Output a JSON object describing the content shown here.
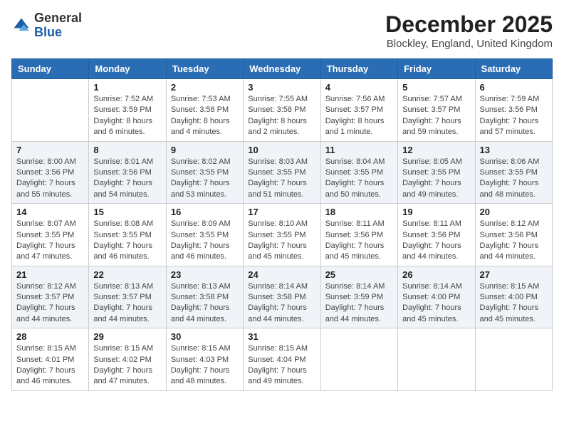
{
  "header": {
    "logo_general": "General",
    "logo_blue": "Blue",
    "month_title": "December 2025",
    "location": "Blockley, England, United Kingdom"
  },
  "days_of_week": [
    "Sunday",
    "Monday",
    "Tuesday",
    "Wednesday",
    "Thursday",
    "Friday",
    "Saturday"
  ],
  "weeks": [
    [
      {
        "day": "",
        "info": ""
      },
      {
        "day": "1",
        "info": "Sunrise: 7:52 AM\nSunset: 3:59 PM\nDaylight: 8 hours\nand 6 minutes."
      },
      {
        "day": "2",
        "info": "Sunrise: 7:53 AM\nSunset: 3:58 PM\nDaylight: 8 hours\nand 4 minutes."
      },
      {
        "day": "3",
        "info": "Sunrise: 7:55 AM\nSunset: 3:58 PM\nDaylight: 8 hours\nand 2 minutes."
      },
      {
        "day": "4",
        "info": "Sunrise: 7:56 AM\nSunset: 3:57 PM\nDaylight: 8 hours\nand 1 minute."
      },
      {
        "day": "5",
        "info": "Sunrise: 7:57 AM\nSunset: 3:57 PM\nDaylight: 7 hours\nand 59 minutes."
      },
      {
        "day": "6",
        "info": "Sunrise: 7:59 AM\nSunset: 3:56 PM\nDaylight: 7 hours\nand 57 minutes."
      }
    ],
    [
      {
        "day": "7",
        "info": "Sunrise: 8:00 AM\nSunset: 3:56 PM\nDaylight: 7 hours\nand 55 minutes."
      },
      {
        "day": "8",
        "info": "Sunrise: 8:01 AM\nSunset: 3:56 PM\nDaylight: 7 hours\nand 54 minutes."
      },
      {
        "day": "9",
        "info": "Sunrise: 8:02 AM\nSunset: 3:55 PM\nDaylight: 7 hours\nand 53 minutes."
      },
      {
        "day": "10",
        "info": "Sunrise: 8:03 AM\nSunset: 3:55 PM\nDaylight: 7 hours\nand 51 minutes."
      },
      {
        "day": "11",
        "info": "Sunrise: 8:04 AM\nSunset: 3:55 PM\nDaylight: 7 hours\nand 50 minutes."
      },
      {
        "day": "12",
        "info": "Sunrise: 8:05 AM\nSunset: 3:55 PM\nDaylight: 7 hours\nand 49 minutes."
      },
      {
        "day": "13",
        "info": "Sunrise: 8:06 AM\nSunset: 3:55 PM\nDaylight: 7 hours\nand 48 minutes."
      }
    ],
    [
      {
        "day": "14",
        "info": "Sunrise: 8:07 AM\nSunset: 3:55 PM\nDaylight: 7 hours\nand 47 minutes."
      },
      {
        "day": "15",
        "info": "Sunrise: 8:08 AM\nSunset: 3:55 PM\nDaylight: 7 hours\nand 46 minutes."
      },
      {
        "day": "16",
        "info": "Sunrise: 8:09 AM\nSunset: 3:55 PM\nDaylight: 7 hours\nand 46 minutes."
      },
      {
        "day": "17",
        "info": "Sunrise: 8:10 AM\nSunset: 3:55 PM\nDaylight: 7 hours\nand 45 minutes."
      },
      {
        "day": "18",
        "info": "Sunrise: 8:11 AM\nSunset: 3:56 PM\nDaylight: 7 hours\nand 45 minutes."
      },
      {
        "day": "19",
        "info": "Sunrise: 8:11 AM\nSunset: 3:56 PM\nDaylight: 7 hours\nand 44 minutes."
      },
      {
        "day": "20",
        "info": "Sunrise: 8:12 AM\nSunset: 3:56 PM\nDaylight: 7 hours\nand 44 minutes."
      }
    ],
    [
      {
        "day": "21",
        "info": "Sunrise: 8:12 AM\nSunset: 3:57 PM\nDaylight: 7 hours\nand 44 minutes."
      },
      {
        "day": "22",
        "info": "Sunrise: 8:13 AM\nSunset: 3:57 PM\nDaylight: 7 hours\nand 44 minutes."
      },
      {
        "day": "23",
        "info": "Sunrise: 8:13 AM\nSunset: 3:58 PM\nDaylight: 7 hours\nand 44 minutes."
      },
      {
        "day": "24",
        "info": "Sunrise: 8:14 AM\nSunset: 3:58 PM\nDaylight: 7 hours\nand 44 minutes."
      },
      {
        "day": "25",
        "info": "Sunrise: 8:14 AM\nSunset: 3:59 PM\nDaylight: 7 hours\nand 44 minutes."
      },
      {
        "day": "26",
        "info": "Sunrise: 8:14 AM\nSunset: 4:00 PM\nDaylight: 7 hours\nand 45 minutes."
      },
      {
        "day": "27",
        "info": "Sunrise: 8:15 AM\nSunset: 4:00 PM\nDaylight: 7 hours\nand 45 minutes."
      }
    ],
    [
      {
        "day": "28",
        "info": "Sunrise: 8:15 AM\nSunset: 4:01 PM\nDaylight: 7 hours\nand 46 minutes."
      },
      {
        "day": "29",
        "info": "Sunrise: 8:15 AM\nSunset: 4:02 PM\nDaylight: 7 hours\nand 47 minutes."
      },
      {
        "day": "30",
        "info": "Sunrise: 8:15 AM\nSunset: 4:03 PM\nDaylight: 7 hours\nand 48 minutes."
      },
      {
        "day": "31",
        "info": "Sunrise: 8:15 AM\nSunset: 4:04 PM\nDaylight: 7 hours\nand 49 minutes."
      },
      {
        "day": "",
        "info": ""
      },
      {
        "day": "",
        "info": ""
      },
      {
        "day": "",
        "info": ""
      }
    ]
  ]
}
